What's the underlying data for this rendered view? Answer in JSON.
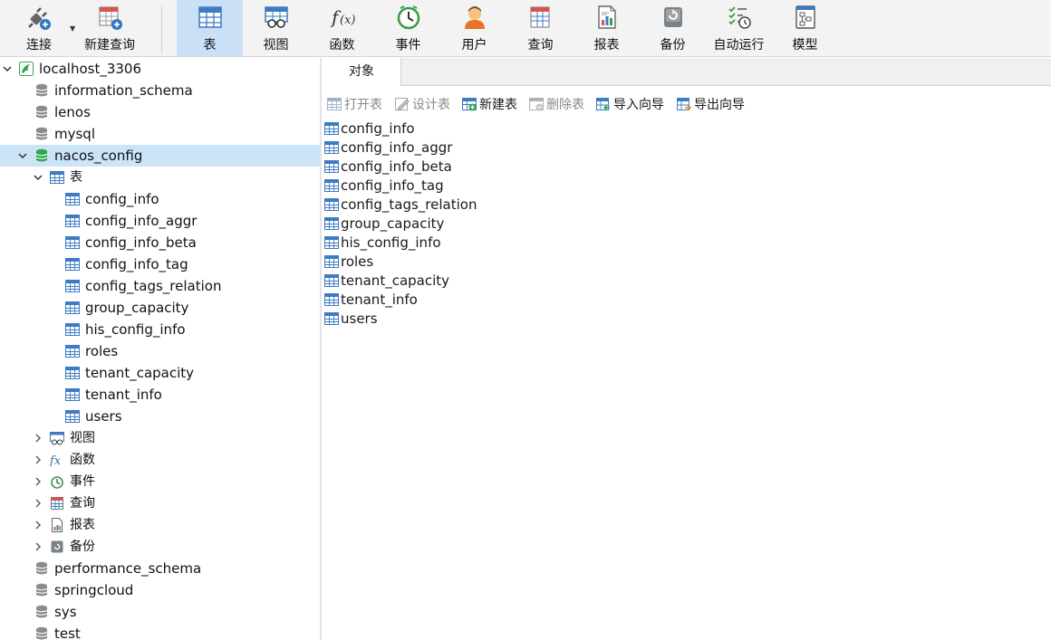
{
  "toolbar": {
    "connect": "连接",
    "new_query": "新建查询",
    "table": "表",
    "view": "视图",
    "function": "函数",
    "event": "事件",
    "user": "用户",
    "query": "查询",
    "report": "报表",
    "backup": "备份",
    "automation": "自动运行",
    "model": "模型"
  },
  "tree": {
    "connection": "localhost_3306",
    "databases_before": [
      "information_schema",
      "lenos",
      "mysql"
    ],
    "selected_database": "nacos_config",
    "groups": {
      "tables": "表",
      "views": "视图",
      "functions": "函数",
      "events": "事件",
      "queries": "查询",
      "reports": "报表",
      "backups": "备份"
    },
    "tables": [
      "config_info",
      "config_info_aggr",
      "config_info_beta",
      "config_info_tag",
      "config_tags_relation",
      "group_capacity",
      "his_config_info",
      "roles",
      "tenant_capacity",
      "tenant_info",
      "users"
    ],
    "databases_after": [
      "performance_schema",
      "springcloud",
      "sys",
      "test"
    ]
  },
  "tabs": {
    "objects": "对象"
  },
  "object_toolbar": {
    "open_table": "打开表",
    "design_table": "设计表",
    "new_table": "新建表",
    "delete_table": "删除表",
    "import_wizard": "导入向导",
    "export_wizard": "导出向导"
  },
  "objects": [
    "config_info",
    "config_info_aggr",
    "config_info_beta",
    "config_info_tag",
    "config_tags_relation",
    "group_capacity",
    "his_config_info",
    "roles",
    "tenant_capacity",
    "tenant_info",
    "users"
  ],
  "colors": {
    "accent_selected": "#cce4f7",
    "toolbar_active": "#c9e0f7",
    "table_icon": "#3d7bc2",
    "db_green": "#2fa84f"
  }
}
